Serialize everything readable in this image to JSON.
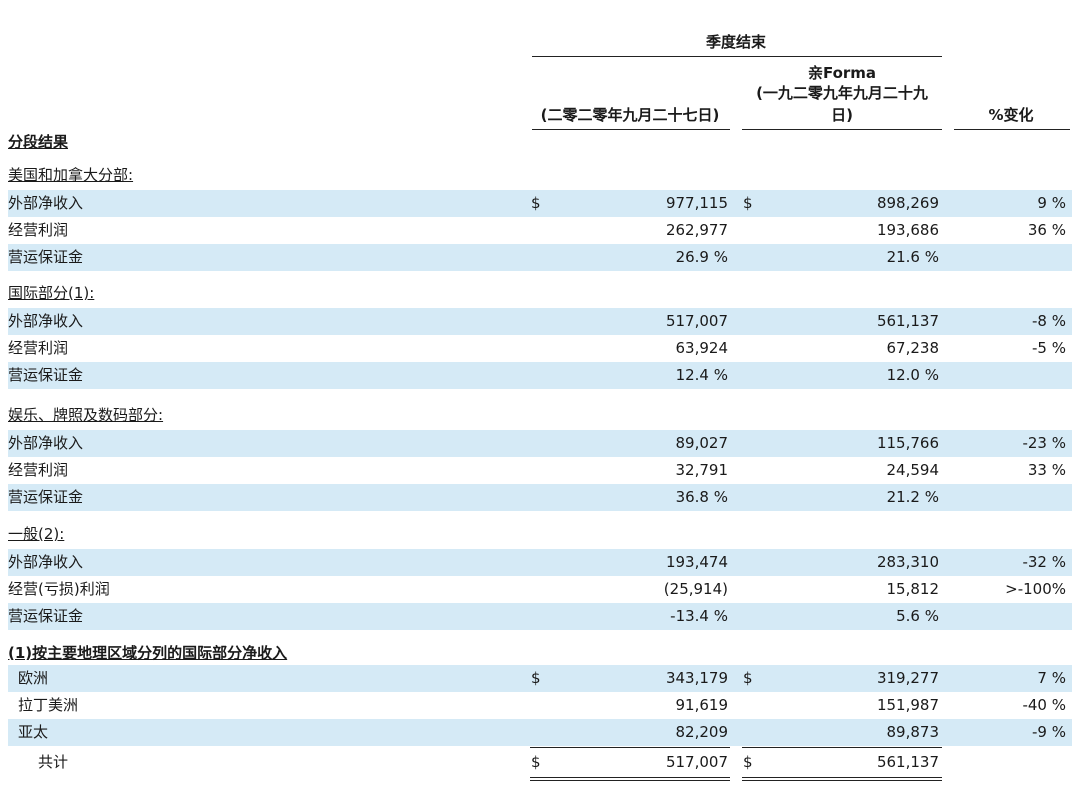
{
  "header": {
    "quarter_end": "季度结束",
    "col1": "(二零二零年九月二十七日)",
    "col2_line1": "亲Forma",
    "col2_line2": "(一九二零九年九月二十九",
    "col2_line3": "日)",
    "col3": "%变化",
    "segment_results": "分段结果"
  },
  "sections": {
    "us_canada": "美国和加拿大分部:",
    "international": "国际部分(1):",
    "entertainment": "娱乐、牌照及数码部分:",
    "general": "一般(2):",
    "footnote": "(1)按主要地理区域分列的国际部分净收入"
  },
  "rows": {
    "us_rev": {
      "label": "外部净收入",
      "d1": "$",
      "v1": "977,115",
      "d2": "$",
      "v2": "898,269",
      "v3": "9 %"
    },
    "us_op": {
      "label": "经营利润",
      "d1": "",
      "v1": "262,977",
      "d2": "",
      "v2": "193,686",
      "v3": "36 %"
    },
    "us_margin": {
      "label": "营运保证金",
      "d1": "",
      "v1": "26.9 %",
      "d2": "",
      "v2": "21.6 %",
      "v3": ""
    },
    "intl_rev": {
      "label": "外部净收入",
      "d1": "",
      "v1": "517,007",
      "d2": "",
      "v2": "561,137",
      "v3": "-8 %"
    },
    "intl_op": {
      "label": "经营利润",
      "d1": "",
      "v1": "63,924",
      "d2": "",
      "v2": "67,238",
      "v3": "-5 %"
    },
    "intl_margin": {
      "label": "营运保证金",
      "d1": "",
      "v1": "12.4 %",
      "d2": "",
      "v2": "12.0 %",
      "v3": ""
    },
    "ent_rev": {
      "label": "外部净收入",
      "d1": "",
      "v1": "89,027",
      "d2": "",
      "v2": "115,766",
      "v3": "-23 %"
    },
    "ent_op": {
      "label": "经营利润",
      "d1": "",
      "v1": "32,791",
      "d2": "",
      "v2": "24,594",
      "v3": "33 %"
    },
    "ent_margin": {
      "label": "营运保证金",
      "d1": "",
      "v1": "36.8 %",
      "d2": "",
      "v2": "21.2 %",
      "v3": ""
    },
    "gen_rev": {
      "label": "外部净收入",
      "d1": "",
      "v1": "193,474",
      "d2": "",
      "v2": "283,310",
      "v3": "-32 %"
    },
    "gen_op": {
      "label": "经营(亏损)利润",
      "d1": "",
      "v1": "(25,914)",
      "d2": "",
      "v2": "15,812",
      "v3": ">-100%"
    },
    "gen_margin": {
      "label": "营运保证金",
      "d1": "",
      "v1": "-13.4 %",
      "d2": "",
      "v2": "5.6 %",
      "v3": ""
    },
    "europe": {
      "label": "欧洲",
      "d1": "$",
      "v1": "343,179",
      "d2": "$",
      "v2": "319,277",
      "v3": "7 %"
    },
    "latam": {
      "label": "拉丁美洲",
      "d1": "",
      "v1": "91,619",
      "d2": "",
      "v2": "151,987",
      "v3": "-40 %"
    },
    "apac": {
      "label": "亚太",
      "d1": "",
      "v1": "82,209",
      "d2": "",
      "v2": "89,873",
      "v3": "-9 %"
    },
    "total": {
      "label": "共计",
      "d1": "$",
      "v1": "517,007",
      "d2": "$",
      "v2": "561,137",
      "v3": ""
    }
  }
}
